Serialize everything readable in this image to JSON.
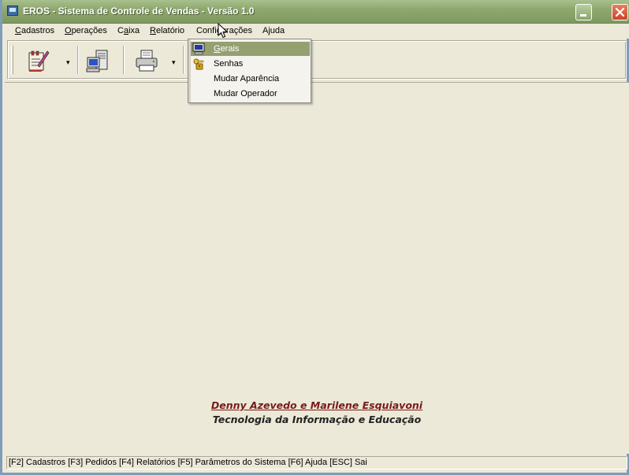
{
  "window": {
    "title": "EROS - Sistema de Controle de Vendas - Versão 1.0"
  },
  "menubar": {
    "items": [
      {
        "label": "Cadastros",
        "accel": "C",
        "rest": "adastros"
      },
      {
        "label": "Operações",
        "accel": "O",
        "rest": "perações"
      },
      {
        "label": "Caixa",
        "pre": "C",
        "accel": "a",
        "rest": "ixa"
      },
      {
        "label": "Relatório",
        "accel": "R",
        "rest": "elatório"
      },
      {
        "label": "Configurações",
        "pre": "Confi",
        "accel": "g",
        "rest": "urações"
      },
      {
        "label": "Ajuda"
      }
    ]
  },
  "config_menu": {
    "items": [
      {
        "label": "Gerais",
        "accel": "G",
        "rest": "erais",
        "icon": "monitor-icon",
        "selected": true
      },
      {
        "label": "Senhas",
        "icon": "keys-icon",
        "selected": false
      },
      {
        "label": "Mudar Aparência",
        "selected": false
      },
      {
        "label": "Mudar Operador",
        "selected": false
      }
    ]
  },
  "toolbar": {
    "buttons": [
      {
        "icon": "cadastros-icon",
        "has_dropdown": true
      },
      {
        "icon": "computer-icon",
        "has_dropdown": false
      },
      {
        "icon": "printer-icon",
        "has_dropdown": true
      }
    ]
  },
  "credits": {
    "line1": "Denny Azevedo e Marilene Esquiavoni",
    "line2": "Tecnologia da Informação e Educação"
  },
  "statusbar": {
    "text": "[F2] Cadastros [F3] Pedidos [F4] Relatórios [F5] Parâmetros do Sistema [F6] Ajuda [ESC] Sai"
  },
  "colors": {
    "titlebar": "#8fa86e",
    "menu_highlight": "#94a070",
    "credits_line1": "#7a1a1a"
  }
}
